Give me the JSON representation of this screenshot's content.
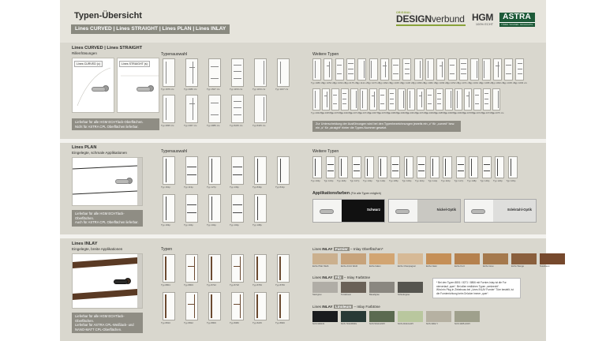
{
  "header": {
    "title": "Typen-Übersicht",
    "subtitle": "Lines CURVED | Lines STRAIGHT | Lines PLAN | Lines INLAY"
  },
  "logos": {
    "designverbund_small": "ORIGINAL",
    "designverbund_main_a": "DESIGN",
    "designverbund_main_b": "verbund",
    "hgm": "HGM",
    "hgm_sub": "100% ECHT",
    "astra": "ASTRA",
    "astra_sub": "TÜREN. WOHNEN. NACHHALTIG.",
    "accent_color": "#8aa33a",
    "astra_color": "#1d5a38"
  },
  "section1": {
    "title": "Lines CURVED | Lines STRAIGHT",
    "subtitle": "Rillenfräsungen",
    "photo_a_caption": "Lines CURVED (c)",
    "photo_b_caption": "Lines STRAIGHT (s)",
    "note": "Lieferbar für alle HGM ECHTlack-Oberflächen.\nNicht für ASTRA CPL Oberflächen lieferbar.",
    "typenauswahl_label": "Typenauswahl",
    "weitere_label": "Weitere Typen",
    "weitere_note": "Zur Unterscheidung der Ausführungen wird bei den Typenbezeichnungen jeweils ein „c“ für „curved“ bzw. ein „s“ für „straight“ hinter die Typen-Nummer gesetzt.",
    "doors_row1": [
      "Typ 1679 c/s",
      "Typ 2086 c/s",
      "Typ 1527 c/s",
      "Typ 1153 c/s",
      "Typ 1153 c/s",
      "Typ 1167 c/s"
    ],
    "doors_row2": [
      "Typ 2835 c/s",
      "Typ 2367 c/s",
      "Typ 2885 c/s",
      "Typ 8245 c/s",
      "Typ 8445 c/s"
    ],
    "weitere_row1": [
      "Typ 1086 c/s",
      "Typ 1052 c/s",
      "Typ 1094 c/s",
      "Typ 2175 c/s",
      "Typ 1111 c/s",
      "Typ 1073 c/s",
      "Typ 1092 c/s",
      "Typ 1045 c/s",
      "Typ 1136 c/s",
      "Typ 1096 c/s",
      "Typ 1082 c/s",
      "Typ 1099 c/s",
      "Typ 1052 c/s",
      "Typ 1071 c/s",
      "Typ 1091 c/s",
      "Typ 1088 c/s",
      "Typ 1090 c/s",
      "Typ 1035 c/s",
      "Typ 1066 c/s"
    ],
    "weitere_row2": [
      "Typ 2062 c/s",
      "Typ 2065 c/s",
      "Typ 2079 c/s",
      "Typ 2040 c/s",
      "Typ 2071 c/s",
      "Typ 2071 c/s",
      "Typ 2067 c/s",
      "Typ 2070 c/s",
      "Typ 2080 c/s",
      "Typ 2060 c/s",
      "Typ 2061 c/s",
      "Typ 2074 c/s",
      "Typ 2069 c/s",
      "Typ 2085 c/s",
      "Typ 2068 c/s",
      "Typ 2066 c/s",
      "Typ 2078 c/s",
      "Typ 2072 c/s",
      "Typ 2073 c/s",
      "Typ 2075 c/s"
    ]
  },
  "section2": {
    "title": "Lines PLAN",
    "subtitle": "Eingelegte, schmale Applikationen",
    "note": "Lieferbar für alle HGM ECHTlack-Oberflächen.\nAuch für ASTRA CPL Oberflächen lieferbar.",
    "typenauswahl_label": "Typenauswahl",
    "weitere_label": "Weitere Typen",
    "doors_row1": [
      "Typ 161p",
      "Typ 113p",
      "Typ 127p",
      "Typ 133p",
      "Typ 843p",
      "Typ 841p"
    ],
    "doors_row2": [
      "Typ 163p",
      "Typ 104p",
      "Typ 102p",
      "Typ 104p",
      "Typ 108p"
    ],
    "weitere_row": [
      "Typ 104p",
      "Typ 103p",
      "Typ 118p",
      "Typ 107p",
      "Typ 132p",
      "Typ 119p",
      "Typ 105p",
      "Typ 109p",
      "Typ 110p",
      "Typ 114p",
      "Typ 116p",
      "Typ 117p",
      "Typ 148p",
      "Typ 149p",
      "Typ 120p",
      "Typ 106p"
    ],
    "applikation_label": "Applikationsfarben",
    "applikation_hint": "(Für alle Typen möglich)",
    "applikation": [
      {
        "name": "Schwarz",
        "color": "#111111"
      },
      {
        "name": "Nickel-Optik",
        "color": "#c9c8c2"
      },
      {
        "name": "Edelstahl-Optik",
        "color": "#dededc"
      }
    ]
  },
  "section3": {
    "title": "Lines INLAY",
    "subtitle": "Eingelegte, breite Applikationen",
    "note": "Lieferbar für alle HGM ECHTlack-Oberflächen.\nLieferbar für ASTRA CPL-Weißlack- und\nNANO-MATT CPL-Oberflächen.",
    "typen_label": "Typen",
    "doors_row1": [
      "Typ 8801",
      "Typ 8803",
      "Typ 8722",
      "Typ 8718",
      "Typ 8769",
      "Typ 8766"
    ],
    "doors_row2": [
      "Typ 8810",
      "Typ 8822",
      "Typ 8806",
      "Typ 8080",
      "Typ 8225",
      "Typ 8826"
    ],
    "furnier_label_a": "Lines ",
    "furnier_label_b": "INLAY",
    "furnier_tag": "Furnier",
    "furnier_label_c": " – Inlay Oberflächen*",
    "furnier": [
      {
        "name": "Eiche Pfalz Weiß",
        "color": "#cbb08e"
      },
      {
        "name": "Eiche Arctic Weiß",
        "color": "#c7a37b"
      },
      {
        "name": "Eiche Italien",
        "color": "#d2a572"
      },
      {
        "name": "Eiche Champagner",
        "color": "#d6b996"
      },
      {
        "name": "Eiche Natur",
        "color": "#c58f57"
      },
      {
        "name": "Eiche Kurz",
        "color": "#b5814e"
      },
      {
        "name": "Eiche Grau",
        "color": "#a5794d"
      },
      {
        "name": "Eiche Wenge",
        "color": "#8a5f3d"
      },
      {
        "name": "Nussbaum",
        "color": "#76492d"
      }
    ],
    "filz_tag": "Filz",
    "filz_label_c": " – Inlay Farbtöne",
    "filz": [
      {
        "name": "Steingrau",
        "color": "#b0ada6"
      },
      {
        "name": "Terrabraun",
        "color": "#6a6157"
      },
      {
        "name": "Basaltgrau",
        "color": "#8a8780"
      },
      {
        "name": "Schiefergrau",
        "color": "#56554f"
      }
    ],
    "linoleum_tag": "Linoleum",
    "linoleum_label_c": " – Inlay Farbtöne",
    "linoleum": [
      {
        "name": "NCS 9000-N",
        "color": "#1a1c1e"
      },
      {
        "name": "NCS 7010-B30G",
        "color": "#283a36"
      },
      {
        "name": "NCS 5010-G50Y",
        "color": "#5b6a50"
      },
      {
        "name": "NCS 2010-G40Y",
        "color": "#b9c79e"
      },
      {
        "name": "NCS 3002-Y",
        "color": "#b6b1a2"
      },
      {
        "name": "NCS 3005-G50Y",
        "color": "#9fa08c"
      }
    ],
    "infobox": "* Bei den Typen 8801 / 8271 / 8806 mit Furnier-Inlay ist die Fur nierverlauf „quer“. Bei allen restlichen Typen „senkrecht“.\nWird ein Plug in Zirbelnuss bei „Lines INLAY Furnier“ Türe bestellt, ist die Furnierrichtung beim Drücker immer „quer“."
  }
}
